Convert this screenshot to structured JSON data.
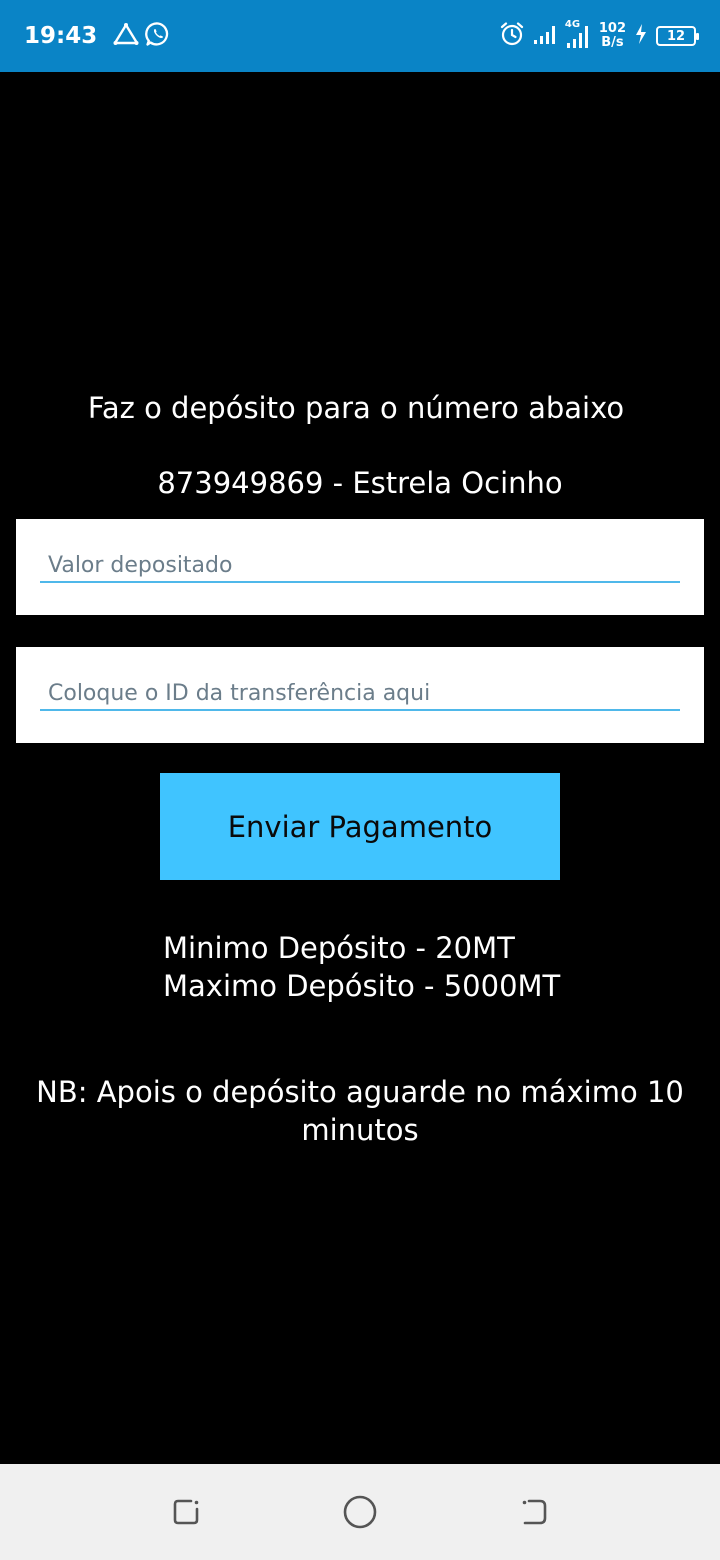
{
  "status_bar": {
    "time": "19:43",
    "network_type": "4G",
    "speed_value": "102",
    "speed_unit": "B/s",
    "battery_level": "12",
    "icons": [
      "drive-icon",
      "whatsapp-icon",
      "alarm-icon",
      "signal-icon",
      "signal-4g-icon",
      "charging-icon",
      "battery-icon"
    ]
  },
  "instructions": {
    "headline": "Faz o depósito para o número abaixo",
    "account": "873949869 - Estrela Ocinho"
  },
  "form": {
    "amount_placeholder": "Valor depositado",
    "amount_value": "",
    "transfer_id_placeholder": "Coloque o ID da transferência aqui",
    "transfer_id_value": "",
    "submit_label": "Enviar Pagamento"
  },
  "limits": {
    "min": "Minimo Depósito - 20MT",
    "max": "Maximo Depósito - 5000MT"
  },
  "note": "NB: Apois o depósito aguarde no máximo 10 minutos",
  "colors": {
    "status_bar_bg": "#0a84c6",
    "page_bg": "#000000",
    "button_bg": "#40c4ff",
    "input_underline": "#4fb8ea",
    "nav_bar_bg": "#f0f0f0"
  },
  "nav": {
    "icons": [
      "recent-apps-icon",
      "home-icon",
      "back-icon"
    ]
  }
}
